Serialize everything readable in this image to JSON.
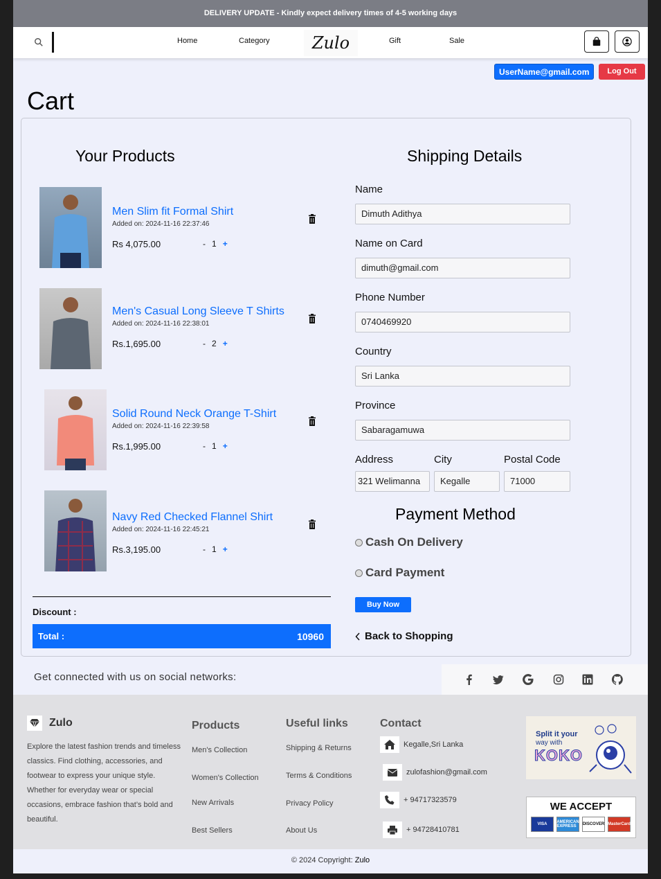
{
  "announcement": "DELIVERY UPDATE - Kindly expect delivery times of 4-5 working days",
  "nav": {
    "links": [
      "Home",
      "Category",
      "Gift",
      "Sale"
    ],
    "logo": "Zulo"
  },
  "user": {
    "email": "UserName@gmail.com",
    "logout": "Log Out"
  },
  "page_title": "Cart",
  "products_heading": "Your Products",
  "products": [
    {
      "name": "Men Slim fit Formal Shirt",
      "added": "Added on: 2024-11-16 22:37:46",
      "price": "Rs 4,075.00",
      "minus": "-",
      "qty": "1",
      "plus": "+",
      "shirt_color": "#5fa0dc"
    },
    {
      "name": "Men's Casual Long Sleeve T Shirts",
      "added": "Added on: 2024-11-16 22:38:01",
      "price": "Rs.1,695.00",
      "minus": "-",
      "qty": "2",
      "plus": "+",
      "shirt_color": "#5c6672"
    },
    {
      "name": "Solid Round Neck Orange T-Shirt",
      "added": "Added on: 2024-11-16 22:39:58",
      "price": "Rs.1,995.00",
      "minus": "-",
      "qty": "1",
      "plus": "+",
      "shirt_color": "#f28a7a"
    },
    {
      "name": "Navy Red Checked Flannel Shirt",
      "added": "Added on: 2024-11-16 22:45:21",
      "price": "Rs.3,195.00",
      "minus": "-",
      "qty": "1",
      "plus": "+",
      "shirt_color": "#3b3c6e"
    }
  ],
  "discount_label": "Discount :",
  "total": {
    "label": "Total :",
    "value": "10960"
  },
  "shipping": {
    "heading": "Shipping Details",
    "name_label": "Name",
    "name_value": "Dimuth Adithya",
    "card_label": "Name on Card",
    "card_value": "dimuth@gmail.com",
    "phone_label": "Phone Number",
    "phone_value": "0740469920",
    "country_label": "Country",
    "country_value": "Sri Lanka",
    "province_label": "Province",
    "province_value": "Sabaragamuwa",
    "address_label": "Address",
    "address_value": "321 Welimanna",
    "city_label": "City",
    "city_value": "Kegalle",
    "postal_label": "Postal Code",
    "postal_value": "71000"
  },
  "payment": {
    "heading": "Payment Method",
    "cod": "Cash On Delivery",
    "card": "Card Payment",
    "buy": "Buy Now",
    "back": "Back to Shopping"
  },
  "social": {
    "text": "Get connected with us on social networks:",
    "icons": [
      "facebook-icon",
      "twitter-icon",
      "google-icon",
      "instagram-icon",
      "linkedin-icon",
      "github-icon"
    ]
  },
  "footer": {
    "brand": "Zulo",
    "description": "Explore the latest fashion trends and timeless classics. Find clothing, accessories, and footwear to express your unique style. Whether for everyday wear or special occasions, embrace fashion that’s bold and beautiful.",
    "products_heading": "Products",
    "products_links": [
      "Men's Collection",
      "Women's Collection",
      "New Arrivals",
      "Best Sellers"
    ],
    "useful_heading": "Useful links",
    "useful_links": [
      "Shipping & Returns",
      "Terms & Conditions",
      "Privacy Policy",
      "About Us"
    ],
    "contact_heading": "Contact",
    "address": "Kegalle,Sri Lanka",
    "email": "zulofashion@gmail.com",
    "phone": "+ 94717323579",
    "fax": "+ 94728410781",
    "koko_line1": "Split it your",
    "koko_line2": "way with",
    "koko_brand": "KOKO",
    "accept": "WE ACCEPT",
    "cards": [
      "VISA",
      "AMERICAN EXPRESS",
      "DISCOVER",
      "MasterCard"
    ]
  },
  "copyright": {
    "prefix": "© 2024 Copyright:",
    "brand": "Zulo"
  }
}
